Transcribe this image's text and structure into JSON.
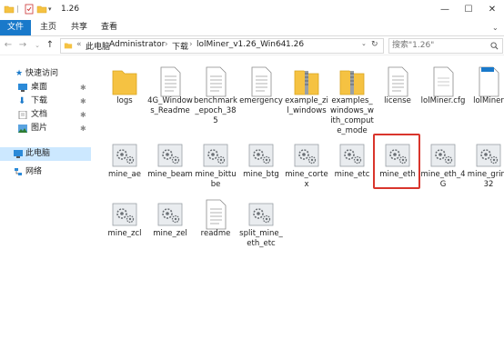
{
  "window": {
    "title": "1.26",
    "controls": {
      "minimize": "—",
      "maximize": "☐",
      "close": "✕"
    }
  },
  "ribbon": {
    "tabs": [
      "文件",
      "主页",
      "共享",
      "查看"
    ]
  },
  "address": {
    "crumbs": [
      "此电脑",
      "Administrator",
      "下载",
      "lolMiner_v1.26_Win64",
      "1.26"
    ],
    "prefix": "«"
  },
  "search": {
    "placeholder": "搜索\"1.26\""
  },
  "nav": {
    "quick_access": "快速访问",
    "pinned": [
      "桌面",
      "下载",
      "文档",
      "图片"
    ],
    "this_pc": "此电脑",
    "network": "网络"
  },
  "files": [
    {
      "name": "logs",
      "type": "folder"
    },
    {
      "name": "4G_Windows_Readme",
      "type": "doc"
    },
    {
      "name": "benchmark_epoch_385",
      "type": "doc"
    },
    {
      "name": "emergency",
      "type": "doc"
    },
    {
      "name": "example_zil_windows",
      "type": "zip-folder"
    },
    {
      "name": "examples_windows_with_compute_mode",
      "type": "zip-folder"
    },
    {
      "name": "license",
      "type": "doc"
    },
    {
      "name": "lolMiner.cfg",
      "type": "cfg"
    },
    {
      "name": "lolMiner",
      "type": "exe"
    },
    {
      "name": "mine_ae",
      "type": "bat"
    },
    {
      "name": "mine_beam",
      "type": "bat"
    },
    {
      "name": "mine_bittube",
      "type": "bat"
    },
    {
      "name": "mine_btg",
      "type": "bat"
    },
    {
      "name": "mine_cortex",
      "type": "bat"
    },
    {
      "name": "mine_etc",
      "type": "bat"
    },
    {
      "name": "mine_eth",
      "type": "bat",
      "highlighted": true
    },
    {
      "name": "mine_eth_4G",
      "type": "bat"
    },
    {
      "name": "mine_grin_32",
      "type": "bat"
    },
    {
      "name": "mine_zcl",
      "type": "bat"
    },
    {
      "name": "mine_zel",
      "type": "bat"
    },
    {
      "name": "readme",
      "type": "doc"
    },
    {
      "name": "split_mine_eth_etc",
      "type": "bat"
    }
  ],
  "colors": {
    "accent": "#1979ca",
    "highlight": "#d9352c",
    "folder": "#f5c242",
    "selected_bg": "#cce8ff"
  }
}
